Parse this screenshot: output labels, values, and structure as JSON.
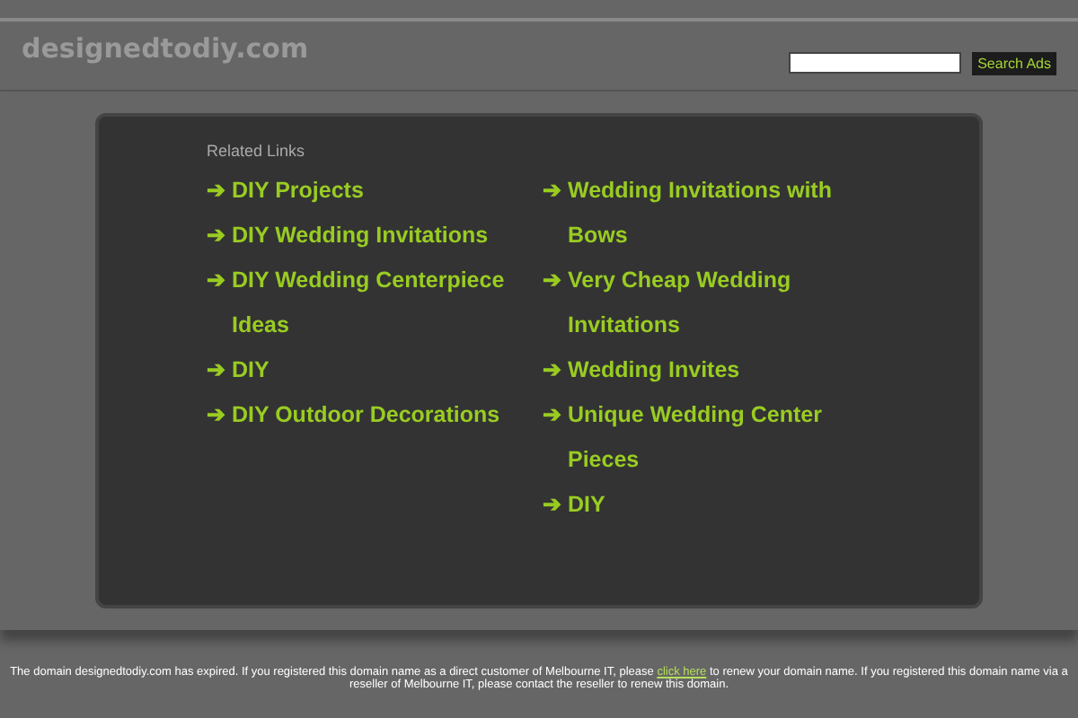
{
  "header": {
    "logo": "designedtodiy.com",
    "search_button": "Search Ads"
  },
  "related_links": {
    "title": "Related Links",
    "arrow": "➔",
    "columns": [
      [
        "DIY Projects",
        "DIY Wedding Invitations",
        "DIY Wedding Centerpiece Ideas",
        "DIY",
        "DIY Outdoor Decorations"
      ],
      [
        "Wedding Invitations with Bows",
        "Very Cheap Wedding Invitations",
        "Wedding Invites",
        "Unique Wedding Center Pieces",
        "DIY"
      ]
    ]
  },
  "footer": {
    "before": "The domain designedtodiy.com has expired. If you registered this domain name as a direct customer of Melbourne IT, please ",
    "link": "click here",
    "after": " to renew your domain name. If you registered this domain name via a reseller of Melbourne IT, please contact the reseller to renew this domain."
  }
}
